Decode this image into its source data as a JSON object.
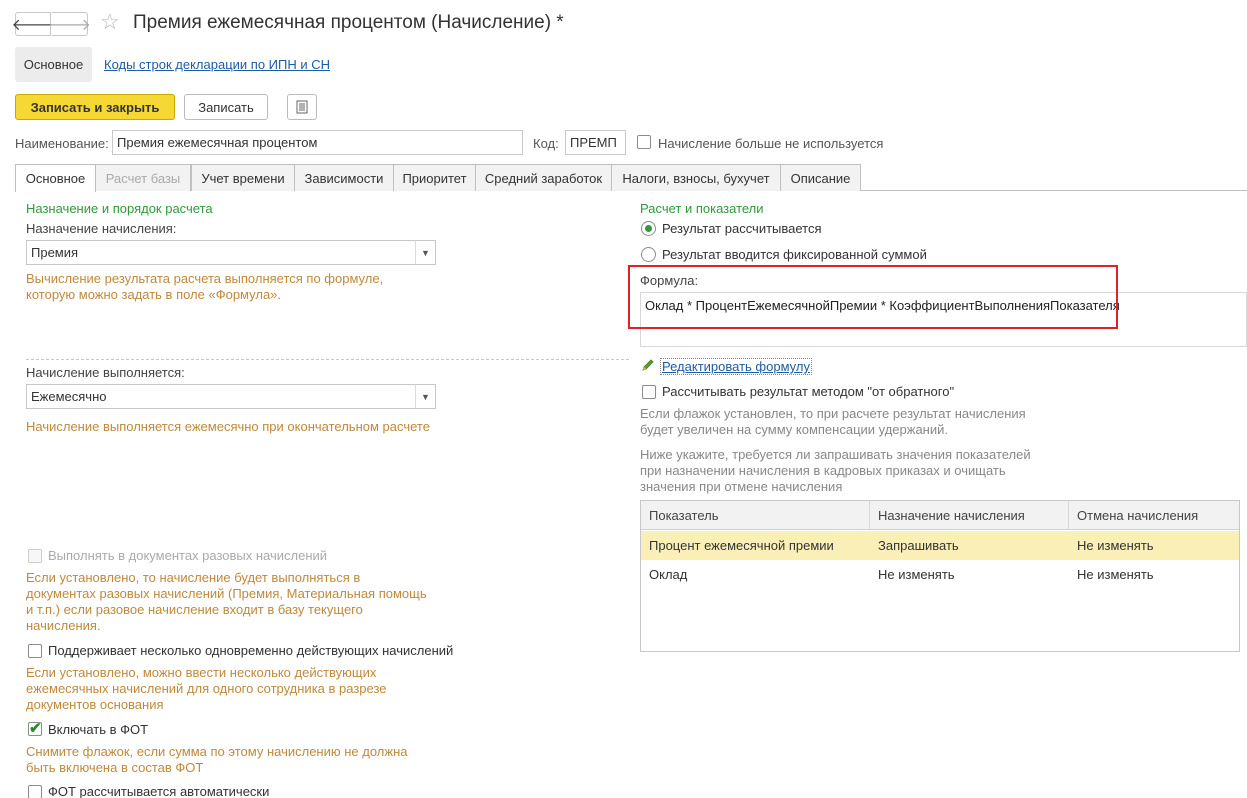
{
  "window": {
    "title": "Премия ежемесячная процентом (Начисление) *"
  },
  "nav": {
    "main_tab": "Основное",
    "link": "Коды строк декларации по ИПН и СН"
  },
  "toolbar": {
    "save_close_label": "Записать и закрыть",
    "save_label": "Записать"
  },
  "header": {
    "name_label": "Наименование:",
    "name_value": "Премия ежемесячная процентом",
    "code_label": "Код:",
    "code_value": "ПРЕМП",
    "unused_label": "Начисление больше не используется",
    "unused_checked": false
  },
  "tabs": [
    {
      "label": "Основное",
      "active": true,
      "disabled": false
    },
    {
      "label": "Расчет базы",
      "active": false,
      "disabled": true
    },
    {
      "label": "Учет времени",
      "active": false,
      "disabled": false
    },
    {
      "label": "Зависимости",
      "active": false,
      "disabled": false
    },
    {
      "label": "Приоритет",
      "active": false,
      "disabled": false
    },
    {
      "label": "Средний заработок",
      "active": false,
      "disabled": false
    },
    {
      "label": "Налоги, взносы, бухучет",
      "active": false,
      "disabled": false
    },
    {
      "label": "Описание",
      "active": false,
      "disabled": false
    }
  ],
  "left": {
    "section_title": "Назначение и порядок расчета",
    "purpose_label": "Назначение начисления:",
    "purpose_value": "Премия",
    "purpose_hint_1": "Вычисление результата расчета выполняется по формуле,",
    "purpose_hint_2": "которую можно задать в поле «Формула».",
    "exec_label": "Начисление выполняется:",
    "exec_value": "Ежемесячно",
    "exec_hint": "Начисление выполняется ежемесячно при окончательном расчете",
    "oneoff_label": "Выполнять в документах разовых начислений",
    "oneoff_hint": [
      "Если установлено, то начисление будет выполняться в",
      "документах разовых начислений (Премия, Материальная помощь",
      "и т.п.) если разовое начисление входит в базу текущего",
      "начисления."
    ],
    "multi_label": "Поддерживает несколько одновременно действующих начислений",
    "multi_hint": [
      "Если установлено, можно ввести несколько действующих",
      "ежемесячных начислений для одного сотрудника в разрезе",
      "документов основания"
    ],
    "fot_label": "Включать в ФОТ",
    "fot_checked": true,
    "fot_hint": [
      "Снимите флажок, если сумма по этому начислению не должна",
      "быть включена в состав ФОТ"
    ],
    "fot_auto_label": "ФОТ рассчитывается автоматически"
  },
  "right": {
    "section_title": "Расчет и показатели",
    "radio_calc": "Результат рассчитывается",
    "radio_fixed": "Результат вводится фиксированной суммой",
    "formula_label": "Формула:",
    "formula_value": "Оклад * ПроцентЕжемесячнойПремии * КоэффициентВыполненияПоказателя",
    "edit_formula_link": "Редактировать формулу",
    "reverse_label": "Рассчитывать результат методом \"от обратного\"",
    "reverse_hint": [
      "Если флажок установлен, то при расчете результат начисления",
      "будет увеличен на сумму компенсации удержаний."
    ],
    "indicators_hint": [
      "Ниже укажите, требуется ли запрашивать значения показателей",
      "при назначении начисления в кадровых приказах и очищать",
      "значения при отмене начисления"
    ],
    "table": {
      "columns": [
        "Показатель",
        "Назначение начисления",
        "Отмена начисления"
      ],
      "rows": [
        [
          "Процент ежемесячной премии",
          "Запрашивать",
          "Не изменять"
        ],
        [
          "Оклад",
          "Не изменять",
          "Не изменять"
        ]
      ]
    }
  },
  "colors": {
    "accent_green": "#2e9b3a",
    "hint_orange": "#c0893a",
    "primary_button": "#f5d834",
    "highlight_red": "#e0202a",
    "selected_row": "#fbefb8"
  }
}
